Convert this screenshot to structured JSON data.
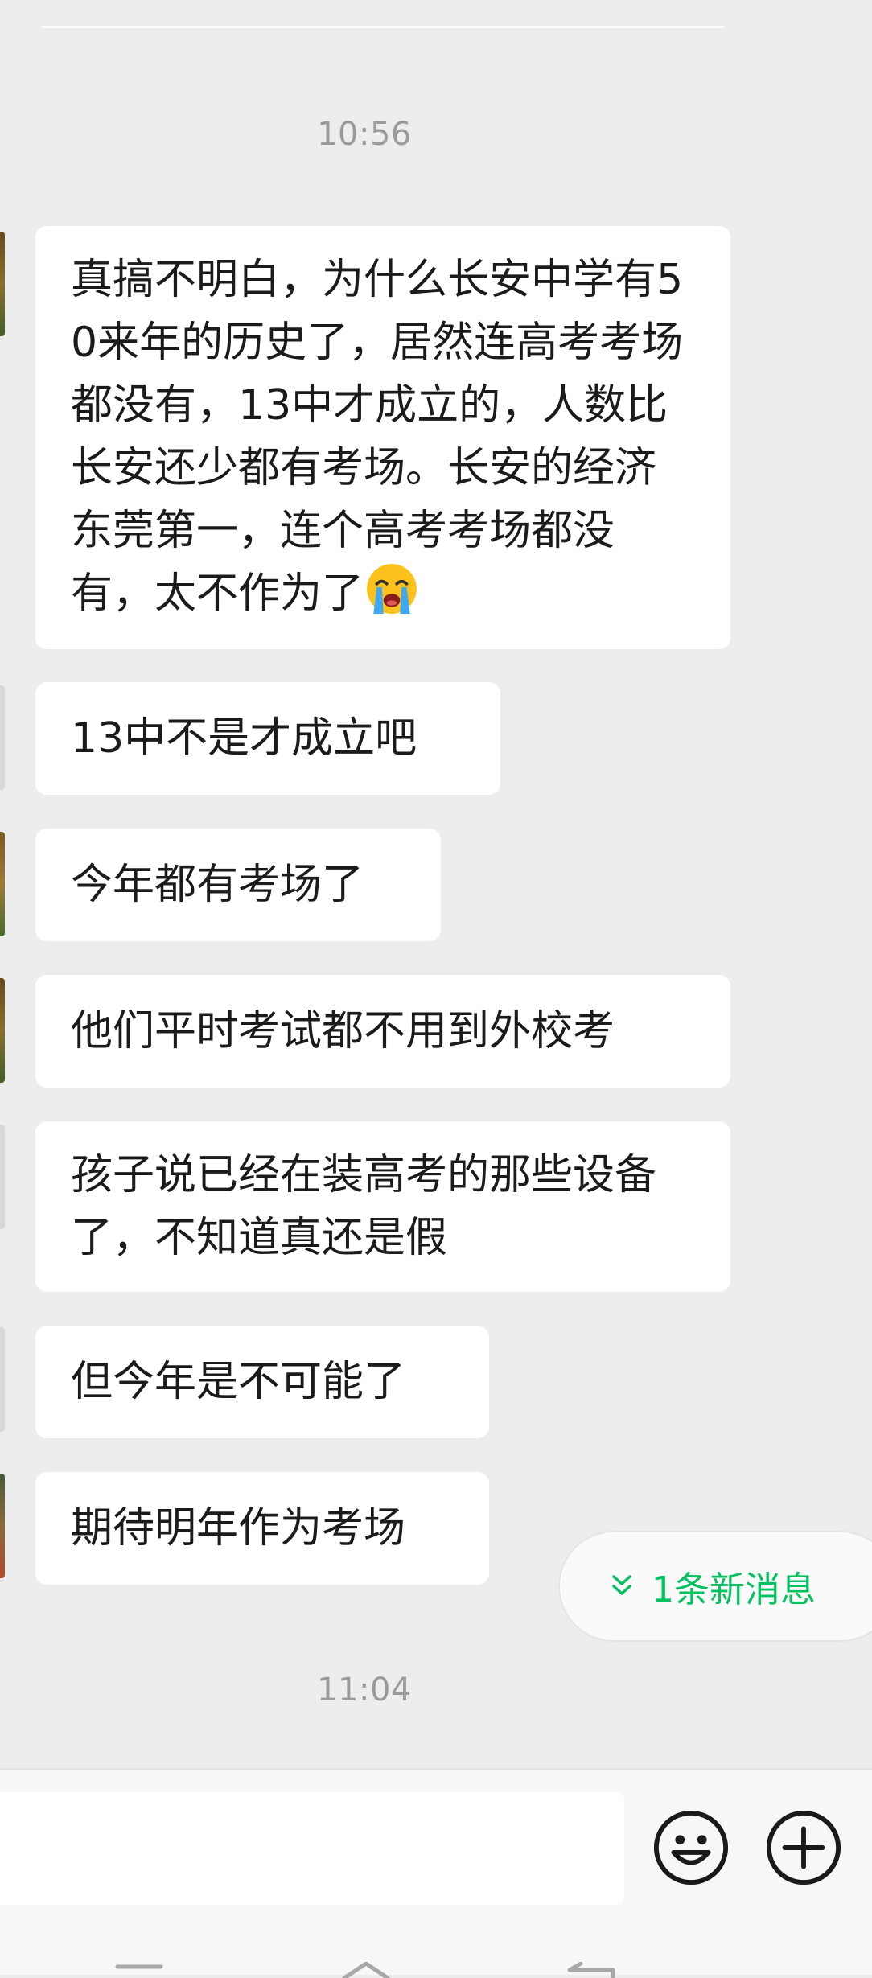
{
  "timestamps": [
    "10:56",
    "11:04"
  ],
  "messages": [
    {
      "text": "真搞不明白，为什么长安中学有50来年的历史了，居然连高考考场都没有，13中才成立的，人数比长安还少都有考场。长安的经济东莞第一，连个高考考场都没有，太不作为了",
      "emoji": "crying-face"
    },
    {
      "text": "13中不是才成立吧"
    },
    {
      "text": "今年都有考场了"
    },
    {
      "text": "他们平时考试都不用到外校考"
    },
    {
      "text": "孩子说已经在装高考的那些设备了，不知道真还是假"
    },
    {
      "text": "但今年是不可能了"
    },
    {
      "text": "期待明年作为考场"
    }
  ],
  "new_message_pill": {
    "label": "1条新消息"
  },
  "colors": {
    "background": "#ededed",
    "bubble": "#ffffff",
    "accent_green": "#07c160",
    "timestamp": "#9a9a9a"
  },
  "icons": {
    "emoji_button": "smiley-face-icon",
    "more_button": "plus-circle-icon",
    "nav": [
      "menu-icon",
      "home-icon",
      "back-icon"
    ]
  }
}
